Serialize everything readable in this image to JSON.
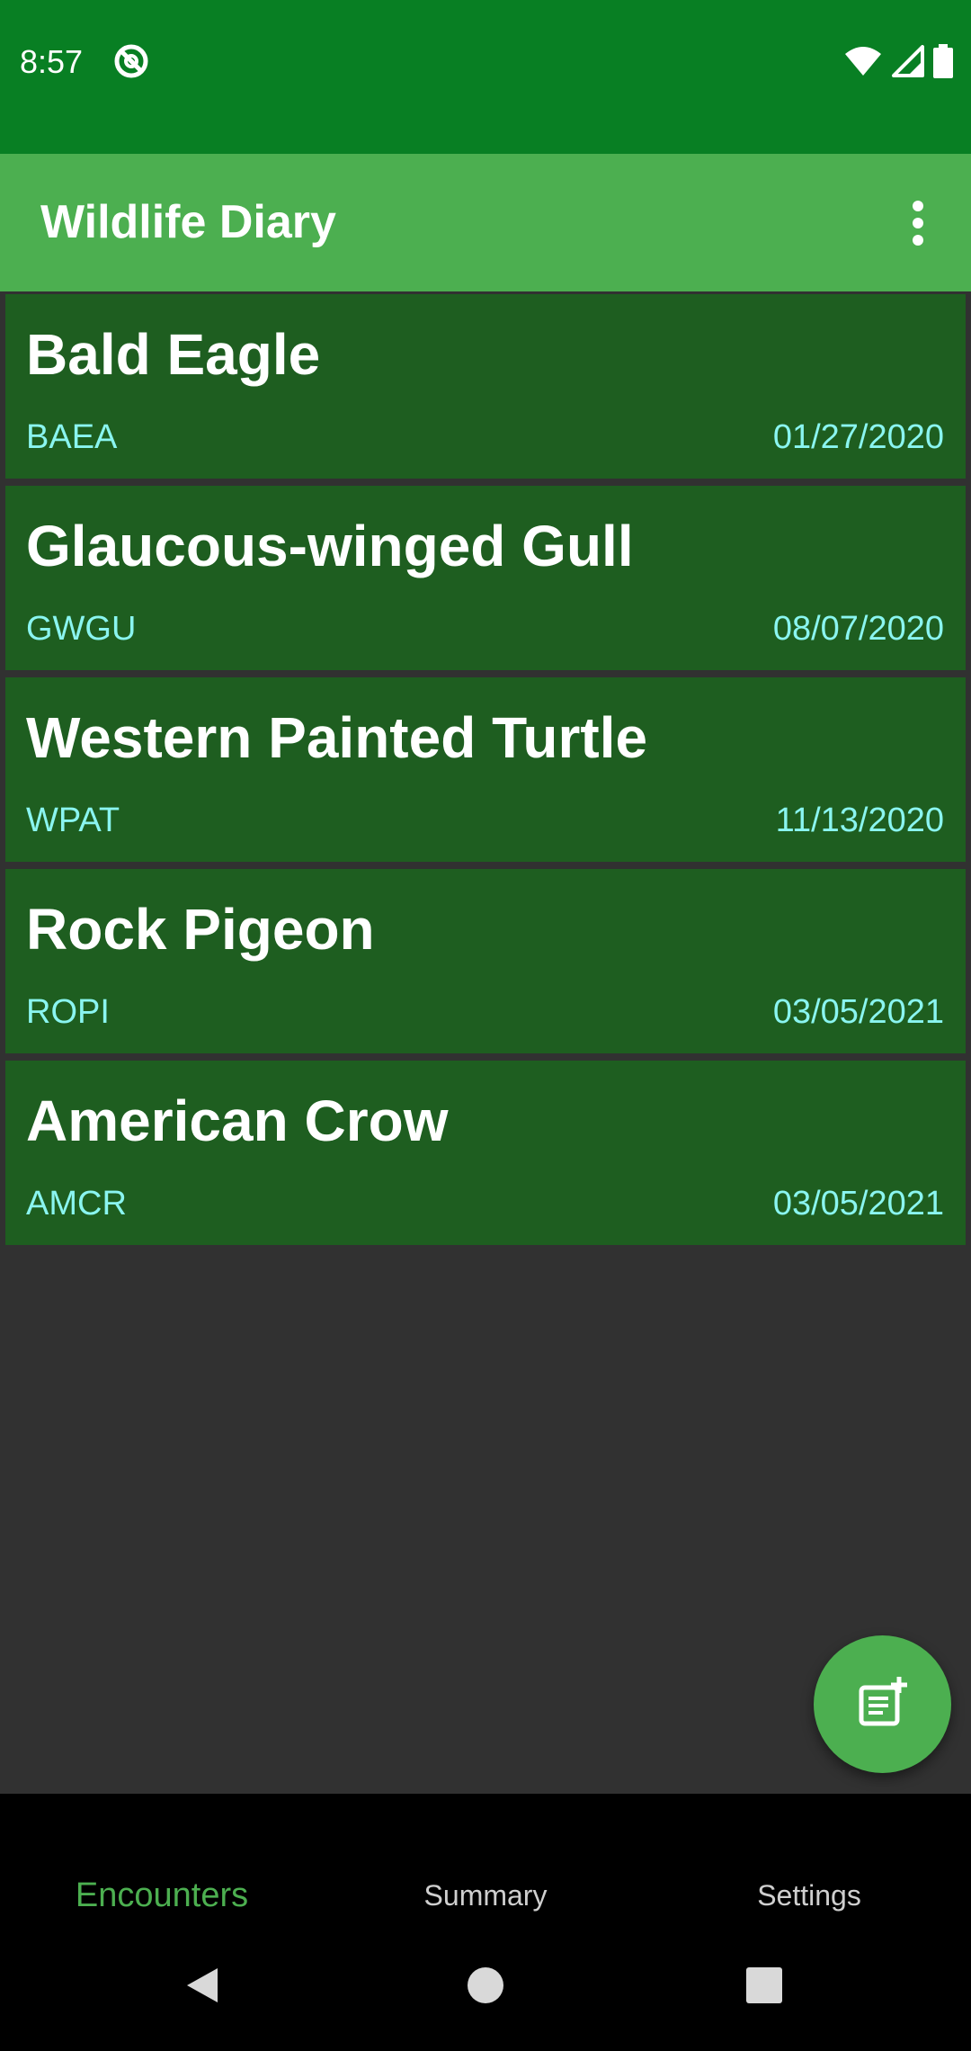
{
  "status_bar": {
    "time": "8:57",
    "app_icon": "sync-off-icon",
    "icons": [
      "wifi-icon",
      "cell-signal-icon",
      "battery-icon"
    ]
  },
  "app_bar": {
    "title": "Wildlife Diary",
    "menu_icon": "more-vert-icon"
  },
  "encounters": [
    {
      "name": "Bald Eagle",
      "code": "BAEA",
      "date": "01/27/2020"
    },
    {
      "name": "Glaucous-winged Gull",
      "code": "GWGU",
      "date": "08/07/2020"
    },
    {
      "name": "Western Painted Turtle",
      "code": "WPAT",
      "date": "11/13/2020"
    },
    {
      "name": "Rock Pigeon",
      "code": "ROPI",
      "date": "03/05/2021"
    },
    {
      "name": "American Crow",
      "code": "AMCR",
      "date": "03/05/2021"
    }
  ],
  "fab": {
    "icon": "note-add-icon"
  },
  "bottom_nav": {
    "items": [
      {
        "label": "Encounters",
        "active": true
      },
      {
        "label": "Summary",
        "active": false
      },
      {
        "label": "Settings",
        "active": false
      }
    ]
  },
  "system_nav": {
    "icons": [
      "back-icon",
      "home-icon",
      "recents-icon"
    ]
  },
  "colors": {
    "status_bar": "#087F23",
    "app_bar": "#4CAF50",
    "card": "#1E5E20",
    "accent_text": "#8AF5F0",
    "background": "#313131",
    "nav_active": "#4CAF50"
  }
}
